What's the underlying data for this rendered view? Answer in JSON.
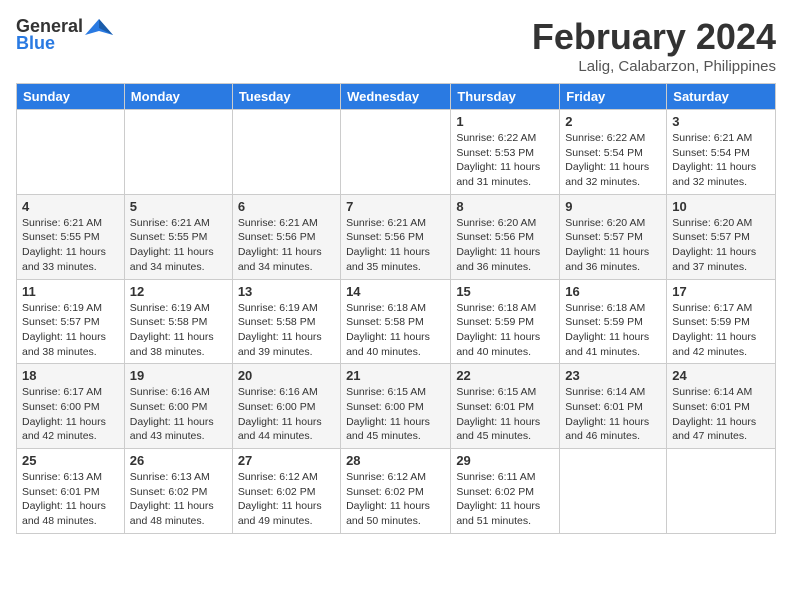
{
  "logo": {
    "general": "General",
    "blue": "Blue"
  },
  "title": "February 2024",
  "location": "Lalig, Calabarzon, Philippines",
  "days_header": [
    "Sunday",
    "Monday",
    "Tuesday",
    "Wednesday",
    "Thursday",
    "Friday",
    "Saturday"
  ],
  "weeks": [
    [
      {
        "day": "",
        "info": ""
      },
      {
        "day": "",
        "info": ""
      },
      {
        "day": "",
        "info": ""
      },
      {
        "day": "",
        "info": ""
      },
      {
        "day": "1",
        "info": "Sunrise: 6:22 AM\nSunset: 5:53 PM\nDaylight: 11 hours and 31 minutes."
      },
      {
        "day": "2",
        "info": "Sunrise: 6:22 AM\nSunset: 5:54 PM\nDaylight: 11 hours and 32 minutes."
      },
      {
        "day": "3",
        "info": "Sunrise: 6:21 AM\nSunset: 5:54 PM\nDaylight: 11 hours and 32 minutes."
      }
    ],
    [
      {
        "day": "4",
        "info": "Sunrise: 6:21 AM\nSunset: 5:55 PM\nDaylight: 11 hours and 33 minutes."
      },
      {
        "day": "5",
        "info": "Sunrise: 6:21 AM\nSunset: 5:55 PM\nDaylight: 11 hours and 34 minutes."
      },
      {
        "day": "6",
        "info": "Sunrise: 6:21 AM\nSunset: 5:56 PM\nDaylight: 11 hours and 34 minutes."
      },
      {
        "day": "7",
        "info": "Sunrise: 6:21 AM\nSunset: 5:56 PM\nDaylight: 11 hours and 35 minutes."
      },
      {
        "day": "8",
        "info": "Sunrise: 6:20 AM\nSunset: 5:56 PM\nDaylight: 11 hours and 36 minutes."
      },
      {
        "day": "9",
        "info": "Sunrise: 6:20 AM\nSunset: 5:57 PM\nDaylight: 11 hours and 36 minutes."
      },
      {
        "day": "10",
        "info": "Sunrise: 6:20 AM\nSunset: 5:57 PM\nDaylight: 11 hours and 37 minutes."
      }
    ],
    [
      {
        "day": "11",
        "info": "Sunrise: 6:19 AM\nSunset: 5:57 PM\nDaylight: 11 hours and 38 minutes."
      },
      {
        "day": "12",
        "info": "Sunrise: 6:19 AM\nSunset: 5:58 PM\nDaylight: 11 hours and 38 minutes."
      },
      {
        "day": "13",
        "info": "Sunrise: 6:19 AM\nSunset: 5:58 PM\nDaylight: 11 hours and 39 minutes."
      },
      {
        "day": "14",
        "info": "Sunrise: 6:18 AM\nSunset: 5:58 PM\nDaylight: 11 hours and 40 minutes."
      },
      {
        "day": "15",
        "info": "Sunrise: 6:18 AM\nSunset: 5:59 PM\nDaylight: 11 hours and 40 minutes."
      },
      {
        "day": "16",
        "info": "Sunrise: 6:18 AM\nSunset: 5:59 PM\nDaylight: 11 hours and 41 minutes."
      },
      {
        "day": "17",
        "info": "Sunrise: 6:17 AM\nSunset: 5:59 PM\nDaylight: 11 hours and 42 minutes."
      }
    ],
    [
      {
        "day": "18",
        "info": "Sunrise: 6:17 AM\nSunset: 6:00 PM\nDaylight: 11 hours and 42 minutes."
      },
      {
        "day": "19",
        "info": "Sunrise: 6:16 AM\nSunset: 6:00 PM\nDaylight: 11 hours and 43 minutes."
      },
      {
        "day": "20",
        "info": "Sunrise: 6:16 AM\nSunset: 6:00 PM\nDaylight: 11 hours and 44 minutes."
      },
      {
        "day": "21",
        "info": "Sunrise: 6:15 AM\nSunset: 6:00 PM\nDaylight: 11 hours and 45 minutes."
      },
      {
        "day": "22",
        "info": "Sunrise: 6:15 AM\nSunset: 6:01 PM\nDaylight: 11 hours and 45 minutes."
      },
      {
        "day": "23",
        "info": "Sunrise: 6:14 AM\nSunset: 6:01 PM\nDaylight: 11 hours and 46 minutes."
      },
      {
        "day": "24",
        "info": "Sunrise: 6:14 AM\nSunset: 6:01 PM\nDaylight: 11 hours and 47 minutes."
      }
    ],
    [
      {
        "day": "25",
        "info": "Sunrise: 6:13 AM\nSunset: 6:01 PM\nDaylight: 11 hours and 48 minutes."
      },
      {
        "day": "26",
        "info": "Sunrise: 6:13 AM\nSunset: 6:02 PM\nDaylight: 11 hours and 48 minutes."
      },
      {
        "day": "27",
        "info": "Sunrise: 6:12 AM\nSunset: 6:02 PM\nDaylight: 11 hours and 49 minutes."
      },
      {
        "day": "28",
        "info": "Sunrise: 6:12 AM\nSunset: 6:02 PM\nDaylight: 11 hours and 50 minutes."
      },
      {
        "day": "29",
        "info": "Sunrise: 6:11 AM\nSunset: 6:02 PM\nDaylight: 11 hours and 51 minutes."
      },
      {
        "day": "",
        "info": ""
      },
      {
        "day": "",
        "info": ""
      }
    ]
  ]
}
